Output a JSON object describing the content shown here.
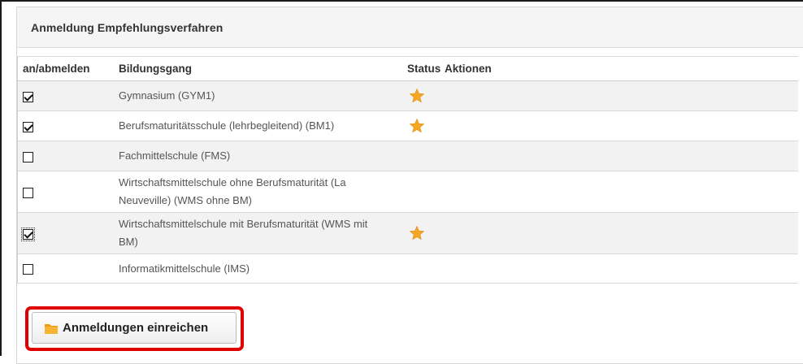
{
  "panel": {
    "title": "Anmeldung Empfehlungsverfahren"
  },
  "table": {
    "headers": {
      "register": "an/abmelden",
      "program": "Bildungsgang",
      "status": "Status",
      "actions": "Aktionen"
    },
    "rows": [
      {
        "checked": true,
        "program_lines": [
          "Gymnasium (GYM1)"
        ],
        "status_icon": "star-icon"
      },
      {
        "checked": true,
        "program_lines": [
          "Berufsmaturitätsschule (lehrbegleitend) (BM1)"
        ],
        "status_icon": "star-icon"
      },
      {
        "checked": false,
        "program_lines": [
          "Fachmittelschule (FMS)"
        ],
        "status_icon": ""
      },
      {
        "checked": false,
        "program_lines": [
          "Wirtschaftsmittelschule ohne Berufsmaturität (La",
          "Neuveville) (WMS ohne BM)"
        ],
        "status_icon": ""
      },
      {
        "checked": true,
        "program_lines": [
          "Wirtschaftsmittelschule mit Berufsmaturität (WMS mit",
          "BM)"
        ],
        "status_icon": "star-icon",
        "focused": true
      },
      {
        "checked": false,
        "program_lines": [
          "Informatikmittelschule (IMS)"
        ],
        "status_icon": ""
      }
    ]
  },
  "submit": {
    "label": "Anmeldungen einreichen",
    "icon": "folder-icon"
  },
  "colors": {
    "highlight": "#e00000",
    "star": "#f5a623",
    "folder": "#f39c12"
  }
}
